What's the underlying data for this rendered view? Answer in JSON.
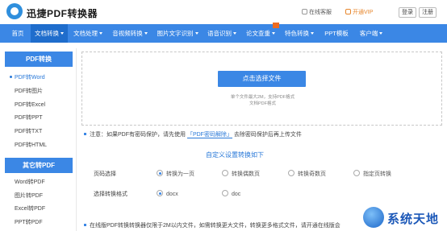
{
  "header": {
    "brand": "迅捷PDF转换器",
    "links": [
      "在线客服",
      "开通VIP"
    ],
    "login": "登录",
    "register": "注册"
  },
  "nav": {
    "items": [
      "首页",
      "文档转换",
      "文档处理",
      "音视频转换",
      "图片文字识别",
      "语音识别",
      "论文查重",
      "特色转换",
      "PPT模板",
      "客户端"
    ],
    "active_index": 1
  },
  "sidebar": {
    "section1_title": "PDF转换",
    "section1_items": [
      "PDF转Word",
      "PDF转图片",
      "PDF转Excel",
      "PDF转PPT",
      "PDF转TXT",
      "PDF转HTML"
    ],
    "active_item": "PDF转Word",
    "section2_title": "其它转PDF",
    "section2_items": [
      "Word转PDF",
      "图片转PDF",
      "Excel转PDF",
      "PPT转PDF"
    ]
  },
  "upload": {
    "button": "点击选择文件",
    "tip1": "单个文件最大2M，支持PDF格式",
    "tip2": "文档PDF格式"
  },
  "note": {
    "prefix": "注意：如果PDF有密码保护，请先使用",
    "link": "「PDF密码解除」",
    "suffix": "去除密码保护后再上传文件"
  },
  "settings": {
    "title": "自定义设置转换如下",
    "page_label": "页码选择",
    "page_options": [
      "转换为一页",
      "转换偶数页",
      "转换奇数页",
      "指定页转换"
    ],
    "page_selected": 0,
    "format_label": "选择转换格式",
    "format_options": [
      "docx",
      "doc"
    ],
    "format_selected": 0
  },
  "bottom_note": "在线版PDF转换转换器仅限于2M以内文件，如需转换更大文件，转换更多格式文件，请开通在线版会",
  "watermark": "系统天地",
  "colors": {
    "accent": "#3b87e5",
    "vip": "#e7862c"
  }
}
